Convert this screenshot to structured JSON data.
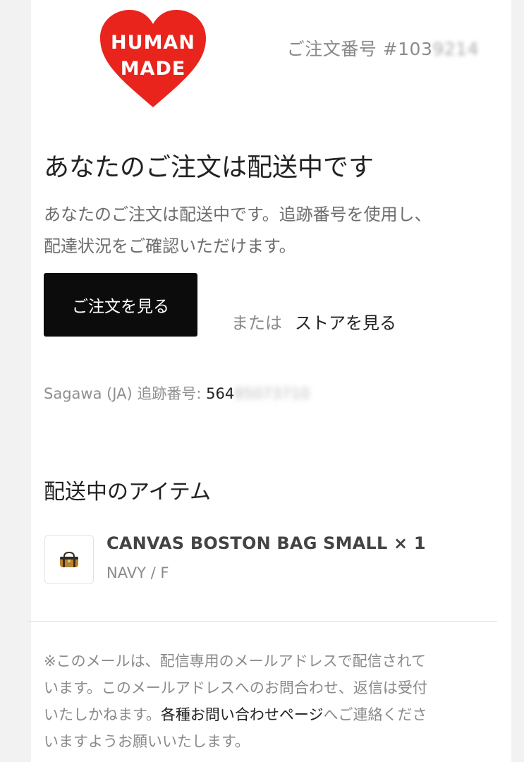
{
  "brand": {
    "logo_text_line1": "HUMAN",
    "logo_text_line2": "MADE",
    "logo_color": "#e8241d"
  },
  "order": {
    "number_visible": "ご注文番号 #103",
    "number_obscured": "9214"
  },
  "headline": "あなたのご注文は配送中です",
  "description_line1": "あなたのご注文は配送中です。追跡番号を使用し、",
  "description_line2": "配達状況をご確認いただけます。",
  "actions": {
    "view_order_label": "ご注文を見る",
    "or_label": "または",
    "view_store_label": "ストアを見る"
  },
  "tracking": {
    "label": "Sagawa (JA) 追跡番号:",
    "number_visible": "564",
    "number_obscured": "85073710"
  },
  "shipped_items": {
    "title": "配送中のアイテム",
    "items": [
      {
        "name": "CANVAS BOSTON BAG SMALL × 1",
        "variant": "NAVY / F",
        "icon": "bag-icon"
      }
    ]
  },
  "footer": {
    "line1": "※このメールは、配信専用のメールアドレスで配信されて",
    "line2": "います。このメールアドレスへのお問合わせ、返信は受付",
    "line3_prefix": "いたしかねます。",
    "line3_link": "各種お問い合わせページ",
    "line3_suffix": "へご連絡くださ",
    "line4": "いますようお願いいたします。"
  },
  "colors": {
    "button_bg": "#0c0c0c",
    "accent_red": "#e8241d"
  }
}
